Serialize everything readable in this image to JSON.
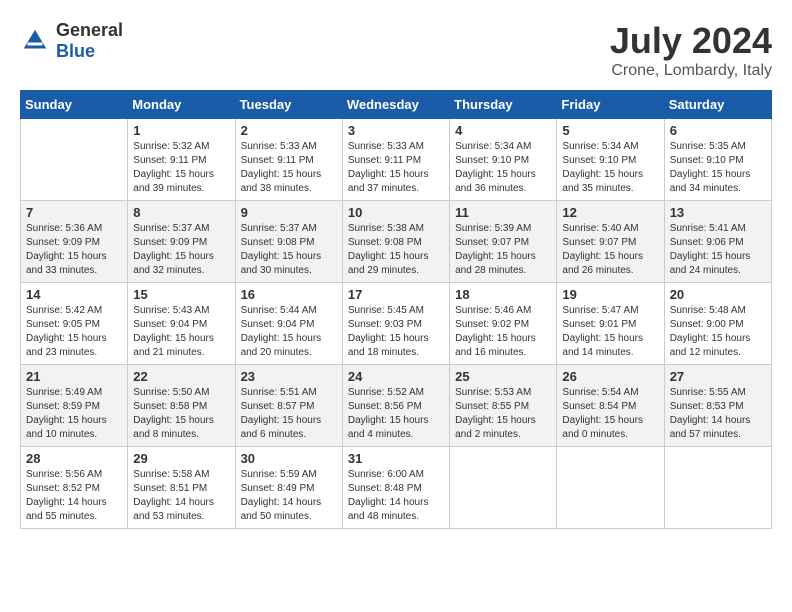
{
  "logo": {
    "general": "General",
    "blue": "Blue"
  },
  "title": {
    "month": "July 2024",
    "location": "Crone, Lombardy, Italy"
  },
  "weekdays": [
    "Sunday",
    "Monday",
    "Tuesday",
    "Wednesday",
    "Thursday",
    "Friday",
    "Saturday"
  ],
  "weeks": [
    [
      {
        "day": "",
        "sunrise": "",
        "sunset": "",
        "daylight": ""
      },
      {
        "day": "1",
        "sunrise": "Sunrise: 5:32 AM",
        "sunset": "Sunset: 9:11 PM",
        "daylight": "Daylight: 15 hours and 39 minutes."
      },
      {
        "day": "2",
        "sunrise": "Sunrise: 5:33 AM",
        "sunset": "Sunset: 9:11 PM",
        "daylight": "Daylight: 15 hours and 38 minutes."
      },
      {
        "day": "3",
        "sunrise": "Sunrise: 5:33 AM",
        "sunset": "Sunset: 9:11 PM",
        "daylight": "Daylight: 15 hours and 37 minutes."
      },
      {
        "day": "4",
        "sunrise": "Sunrise: 5:34 AM",
        "sunset": "Sunset: 9:10 PM",
        "daylight": "Daylight: 15 hours and 36 minutes."
      },
      {
        "day": "5",
        "sunrise": "Sunrise: 5:34 AM",
        "sunset": "Sunset: 9:10 PM",
        "daylight": "Daylight: 15 hours and 35 minutes."
      },
      {
        "day": "6",
        "sunrise": "Sunrise: 5:35 AM",
        "sunset": "Sunset: 9:10 PM",
        "daylight": "Daylight: 15 hours and 34 minutes."
      }
    ],
    [
      {
        "day": "7",
        "sunrise": "Sunrise: 5:36 AM",
        "sunset": "Sunset: 9:09 PM",
        "daylight": "Daylight: 15 hours and 33 minutes."
      },
      {
        "day": "8",
        "sunrise": "Sunrise: 5:37 AM",
        "sunset": "Sunset: 9:09 PM",
        "daylight": "Daylight: 15 hours and 32 minutes."
      },
      {
        "day": "9",
        "sunrise": "Sunrise: 5:37 AM",
        "sunset": "Sunset: 9:08 PM",
        "daylight": "Daylight: 15 hours and 30 minutes."
      },
      {
        "day": "10",
        "sunrise": "Sunrise: 5:38 AM",
        "sunset": "Sunset: 9:08 PM",
        "daylight": "Daylight: 15 hours and 29 minutes."
      },
      {
        "day": "11",
        "sunrise": "Sunrise: 5:39 AM",
        "sunset": "Sunset: 9:07 PM",
        "daylight": "Daylight: 15 hours and 28 minutes."
      },
      {
        "day": "12",
        "sunrise": "Sunrise: 5:40 AM",
        "sunset": "Sunset: 9:07 PM",
        "daylight": "Daylight: 15 hours and 26 minutes."
      },
      {
        "day": "13",
        "sunrise": "Sunrise: 5:41 AM",
        "sunset": "Sunset: 9:06 PM",
        "daylight": "Daylight: 15 hours and 24 minutes."
      }
    ],
    [
      {
        "day": "14",
        "sunrise": "Sunrise: 5:42 AM",
        "sunset": "Sunset: 9:05 PM",
        "daylight": "Daylight: 15 hours and 23 minutes."
      },
      {
        "day": "15",
        "sunrise": "Sunrise: 5:43 AM",
        "sunset": "Sunset: 9:04 PM",
        "daylight": "Daylight: 15 hours and 21 minutes."
      },
      {
        "day": "16",
        "sunrise": "Sunrise: 5:44 AM",
        "sunset": "Sunset: 9:04 PM",
        "daylight": "Daylight: 15 hours and 20 minutes."
      },
      {
        "day": "17",
        "sunrise": "Sunrise: 5:45 AM",
        "sunset": "Sunset: 9:03 PM",
        "daylight": "Daylight: 15 hours and 18 minutes."
      },
      {
        "day": "18",
        "sunrise": "Sunrise: 5:46 AM",
        "sunset": "Sunset: 9:02 PM",
        "daylight": "Daylight: 15 hours and 16 minutes."
      },
      {
        "day": "19",
        "sunrise": "Sunrise: 5:47 AM",
        "sunset": "Sunset: 9:01 PM",
        "daylight": "Daylight: 15 hours and 14 minutes."
      },
      {
        "day": "20",
        "sunrise": "Sunrise: 5:48 AM",
        "sunset": "Sunset: 9:00 PM",
        "daylight": "Daylight: 15 hours and 12 minutes."
      }
    ],
    [
      {
        "day": "21",
        "sunrise": "Sunrise: 5:49 AM",
        "sunset": "Sunset: 8:59 PM",
        "daylight": "Daylight: 15 hours and 10 minutes."
      },
      {
        "day": "22",
        "sunrise": "Sunrise: 5:50 AM",
        "sunset": "Sunset: 8:58 PM",
        "daylight": "Daylight: 15 hours and 8 minutes."
      },
      {
        "day": "23",
        "sunrise": "Sunrise: 5:51 AM",
        "sunset": "Sunset: 8:57 PM",
        "daylight": "Daylight: 15 hours and 6 minutes."
      },
      {
        "day": "24",
        "sunrise": "Sunrise: 5:52 AM",
        "sunset": "Sunset: 8:56 PM",
        "daylight": "Daylight: 15 hours and 4 minutes."
      },
      {
        "day": "25",
        "sunrise": "Sunrise: 5:53 AM",
        "sunset": "Sunset: 8:55 PM",
        "daylight": "Daylight: 15 hours and 2 minutes."
      },
      {
        "day": "26",
        "sunrise": "Sunrise: 5:54 AM",
        "sunset": "Sunset: 8:54 PM",
        "daylight": "Daylight: 15 hours and 0 minutes."
      },
      {
        "day": "27",
        "sunrise": "Sunrise: 5:55 AM",
        "sunset": "Sunset: 8:53 PM",
        "daylight": "Daylight: 14 hours and 57 minutes."
      }
    ],
    [
      {
        "day": "28",
        "sunrise": "Sunrise: 5:56 AM",
        "sunset": "Sunset: 8:52 PM",
        "daylight": "Daylight: 14 hours and 55 minutes."
      },
      {
        "day": "29",
        "sunrise": "Sunrise: 5:58 AM",
        "sunset": "Sunset: 8:51 PM",
        "daylight": "Daylight: 14 hours and 53 minutes."
      },
      {
        "day": "30",
        "sunrise": "Sunrise: 5:59 AM",
        "sunset": "Sunset: 8:49 PM",
        "daylight": "Daylight: 14 hours and 50 minutes."
      },
      {
        "day": "31",
        "sunrise": "Sunrise: 6:00 AM",
        "sunset": "Sunset: 8:48 PM",
        "daylight": "Daylight: 14 hours and 48 minutes."
      },
      {
        "day": "",
        "sunrise": "",
        "sunset": "",
        "daylight": ""
      },
      {
        "day": "",
        "sunrise": "",
        "sunset": "",
        "daylight": ""
      },
      {
        "day": "",
        "sunrise": "",
        "sunset": "",
        "daylight": ""
      }
    ]
  ]
}
